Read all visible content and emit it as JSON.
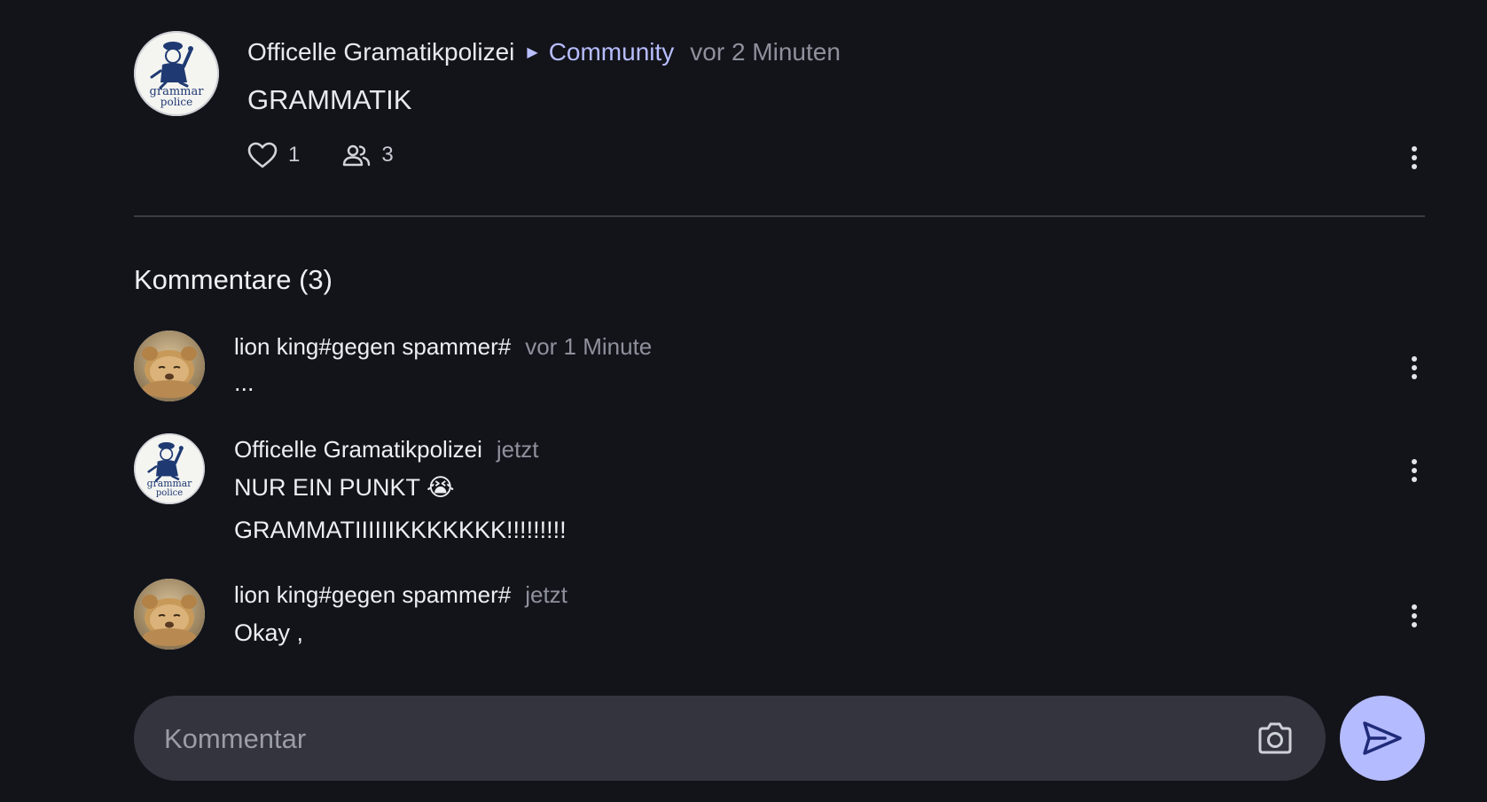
{
  "post": {
    "author": "Officelle Gramatikpolizei",
    "community": "Community",
    "time": "vor 2 Minuten",
    "title": "GRAMMATIK",
    "likes": "1",
    "participants": "3"
  },
  "comments_heading": "Kommentare (3)",
  "comments": [
    {
      "author": "lion king#gegen spammer#",
      "time": "vor 1 Minute",
      "lines": [
        "..."
      ],
      "avatar_icon": "lion-cub-avatar"
    },
    {
      "author": "Officelle Gramatikpolizei",
      "time": "jetzt",
      "lines": [
        "NUR EIN PUNKT 😭",
        "GRAMMATIIIIIIKKKKKKK!!!!!!!!!"
      ],
      "avatar_icon": "grammar-police-avatar"
    },
    {
      "author": "lion king#gegen spammer#",
      "time": "jetzt",
      "lines": [
        "Okay ,"
      ],
      "avatar_icon": "lion-cub-avatar"
    }
  ],
  "composer": {
    "placeholder": "Kommentar",
    "camera_icon": "camera-icon",
    "send_icon": "send-icon"
  },
  "avatar_text": {
    "line1": "grammar",
    "line2": "police"
  },
  "colors": {
    "background": "#13141a",
    "accent": "#b4bbff",
    "muted_text": "#8e919c",
    "input_bg": "#33343d"
  }
}
